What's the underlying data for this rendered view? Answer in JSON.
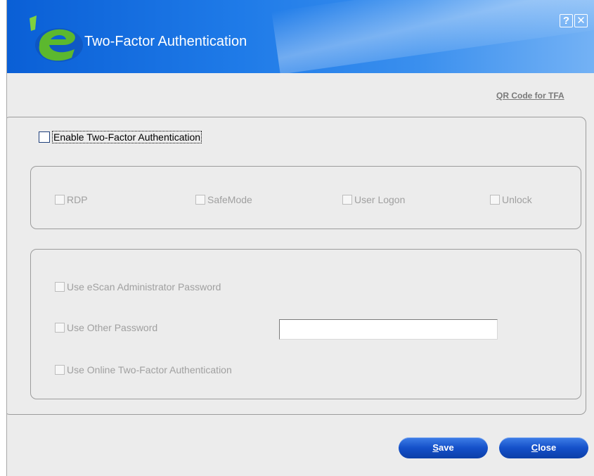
{
  "window": {
    "title": "Two-Factor Authentication",
    "help_label": "?",
    "close_label": "✕"
  },
  "links": {
    "qr_code": "QR Code for TFA"
  },
  "enable_tfa": {
    "label": "Enable Two-Factor Authentication",
    "checked": false
  },
  "options": [
    {
      "label": "RDP",
      "checked": false
    },
    {
      "label": "SafeMode",
      "checked": false
    },
    {
      "label": "User Logon",
      "checked": false
    },
    {
      "label": "Unlock",
      "checked": false
    }
  ],
  "password_options": [
    {
      "label": "Use eScan Administrator Password",
      "checked": false
    },
    {
      "label": "Use Other Password",
      "checked": false
    },
    {
      "label": "Use Online Two-Factor Authentication",
      "checked": false
    }
  ],
  "other_password": {
    "value": ""
  },
  "buttons": {
    "save_mnemonic": "S",
    "save_rest": "ave",
    "close_mnemonic": "C",
    "close_rest": "lose"
  },
  "colors": {
    "titlebar_start": "#0a5fd6",
    "titlebar_end": "#74b2f5",
    "button_blue": "#1450c9",
    "disabled_text": "#a0a0a0",
    "logo_green": "#5cb82e"
  }
}
